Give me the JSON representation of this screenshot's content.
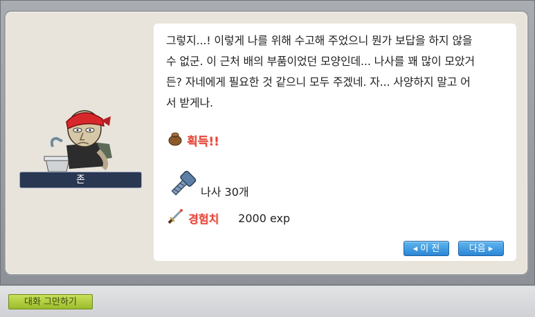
{
  "npc": {
    "name": "존"
  },
  "dialog": {
    "text": "그렇지...! 이렇게 나를 위해 수고해 주었으니 뭔가 보답을 하지 않을\n수 없군. 이 근처 배의 부품이었던 모양인데... 나사를 꽤 많이 모았거\n든? 자네에게 필요한 것 같으니 모두 주겠네. 자... 사양하지 말고 어\n서 받게나."
  },
  "reward": {
    "acquire_label": "획득!!",
    "item_label": "나사 30개",
    "exp_label": "경험치",
    "exp_value": "2000 exp"
  },
  "buttons": {
    "prev_label": "◂ 이 전",
    "next_label": "다음 ▸",
    "end_chat_label": "대화 그만하기"
  },
  "colors": {
    "accent_red": "#e8463a",
    "button_blue": "#2b86d6",
    "end_button_green": "#9cbc2a"
  }
}
